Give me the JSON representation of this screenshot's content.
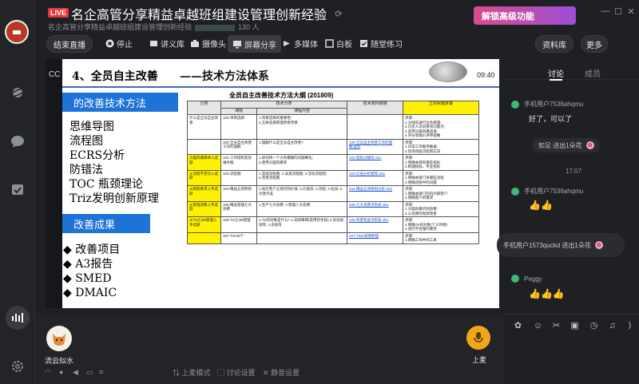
{
  "window": {
    "live_badge": "LIVE",
    "title": "名企高管分享精益卓越班组建设管理创新经验",
    "subtitle_prefix": "名企高管分享精益卓越班组建设管理创新经验",
    "viewer_count": "130 人",
    "unlock_label": "解锁高级功能"
  },
  "toolbar": {
    "end_live": "结束直播",
    "stop": "停止",
    "courseware": "讲义库",
    "camera": "摄像头",
    "screen_share": "屏幕分享",
    "multimedia": "多媒体",
    "whiteboard": "白板",
    "practice": "随堂练习",
    "library": "资料库",
    "more": "更多"
  },
  "slide": {
    "cc_label": "CC",
    "clock": "09:40",
    "heading": "4、全员自主改善",
    "heading_sub": "——技术方法体系",
    "box1": "的改善技术方法",
    "methods": [
      "思维导图",
      "流程图",
      "ECRS分析",
      "防错法",
      "TOC 瓶颈理论",
      "Triz发明创新原理"
    ],
    "box2": "改善成果",
    "results": [
      "◆ 改善项目",
      "◆ A3报告",
      "◆ SMED",
      "◆ DMAIC"
    ],
    "table_title": "全员自主改善技术方法大纲 (201809)",
    "table_headers": [
      "分类",
      "技术分类",
      "技术资料链接",
      "立项实施步骤"
    ],
    "table_subheaders": [
      "课题",
      "课程内容"
    ],
    "rows": [
      {
        "cat": "什么是全员自主改善",
        "topic": "100-项目选择",
        "content": "1.项目选择的重要性;\n2.怎样选择管理改善项目;",
        "link": "",
        "steps": "步骤:\n1.分线先进行业务梳理;\n2.识见人识员要求问题点;\n3.适用头脑风暴选择;\n4.评分等级价评审提确",
        "yellow": false
      },
      {
        "cat": "",
        "topic": "100-全员自主改善工作的理解",
        "content": "1.理解什么是全员自主改善?",
        "link": "100-全员自主改善工作的理解.pptx",
        "steps": "步骤:\n1.日常工作推卷推展;\n2.现场调查流程和实况",
        "yellow": false
      },
      {
        "cat": "头脑风暴群体入选题",
        "topic": "102-工作结构及思维导图",
        "content": "1.如何将一个大的模糊的问题细化;\n2.使用头脑风暴等",
        "link": "102-指标分解树.xlsx",
        "steps": "步骤:\n1.明确本部有哪些指标\n2.梳理指标、专业指标",
        "yellow": true
      },
      {
        "cat": "从流程不足切入选题",
        "topic": "103-流程图",
        "content": "1.常规流程图; 2.泳道流程图; 3.活动流程图;\n4.完善流程图",
        "link": "103-价值分析矩阵.xlsx",
        "steps": "步骤:\n1.明确本部门有哪些流程\n2.明确流程中的问题",
        "yellow": true
      },
      {
        "cat": "从顾客要求入手选题",
        "topic": "104-精益五项原则",
        "content": "1.站在客户立场识别价值; 2.价值流; 3.流程; 4.拉动; 5.尽善尽美",
        "link": "104-精益五项原则分析.xlsx",
        "steps": "步骤:\n1.明确本部门的内外部客户;\n2.明确客户的需求",
        "yellow": true
      },
      {
        "cat": "从管理浪费入手选题",
        "topic": "105-精益管理七大浪费",
        "content": "1.生产七大浪费; 2.管理八大浪费;",
        "link": "105-七大浪费识别表.xlsx",
        "steps": "步骤:\n1.头脑风暴识别浪费;\n2.以浪费的现状改善",
        "yellow": true
      },
      {
        "cat": "从TS之3M管理入手选题",
        "topic": "106-TS之3M管理",
        "content": "1.TS的对象是什么? 2.去除障碍(常用的手段).3.优化规划等; 4.去除等",
        "link": "106-改善机会识别表.xlsx",
        "steps": "步骤:\n1.明确TS的对象(个义的物)\n2.进行不合理的重塑",
        "yellow": true
      },
      {
        "cat": "",
        "topic": "107-Triz40个",
        "content": "",
        "link": "107-TRIZ发明原理",
        "steps": "步骤:\n1.明确工作中的工具",
        "yellow": true
      }
    ]
  },
  "chat": {
    "tab_discussion": "讨论",
    "tab_members": "成员",
    "messages": [
      {
        "user": "手机用户7536ahqmu",
        "text": "好了，可以了"
      },
      {
        "notice": "知足 送出1朵花"
      },
      {
        "time": "17:07"
      },
      {
        "user": "手机用户7536ahqmu",
        "text": "👍👍"
      },
      {
        "notice": "手机用户1573quckd 送出1朵花"
      },
      {
        "user": "Peggy",
        "text": "👍👍👍"
      }
    ]
  },
  "bottom": {
    "presenter_name": "流云似水",
    "mic_label": "上麦",
    "stage_mode": "上麦模式",
    "discussion_settings": "讨论设置",
    "mute_settings": "静音设置"
  }
}
